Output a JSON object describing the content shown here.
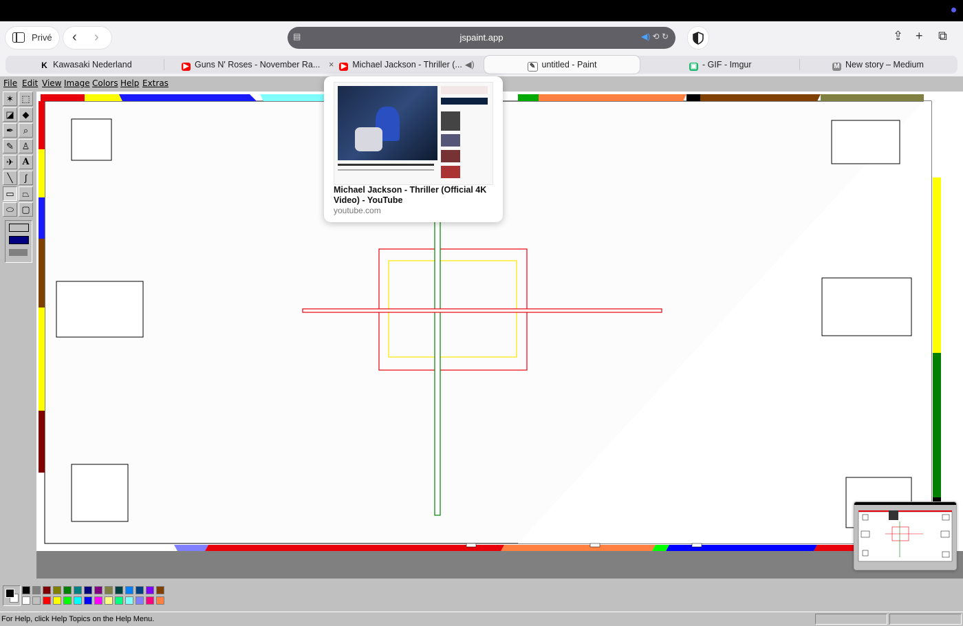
{
  "browser": {
    "profile_label": "Privé",
    "url": "jspaint.app",
    "tabs": [
      {
        "label": "Kawasaki Nederland",
        "icon": "kawasaki-icon"
      },
      {
        "label": "Guns N' Roses - November Ra...",
        "icon": "youtube-icon"
      },
      {
        "label": "Michael Jackson - Thriller (...",
        "icon": "youtube-icon",
        "close": "×"
      },
      {
        "label": "untitled - Paint",
        "icon": "paint-icon",
        "active": true
      },
      {
        "label": "- GIF - Imgur",
        "icon": "imgur-icon"
      },
      {
        "label": "New story – Medium",
        "icon": "medium-icon"
      }
    ],
    "colors": {
      "youtube_red": "#ff0000",
      "url_bar": "#606066",
      "accent": "#5a5cf0"
    }
  },
  "preview": {
    "title": "Michael Jackson - Thriller (Official 4K Video) - YouTube",
    "url": "youtube.com"
  },
  "paint": {
    "menus": [
      "File",
      "Edit",
      "View",
      "Image",
      "Colors",
      "Help",
      "Extras"
    ],
    "status_text": "For Help, click Help Topics on the Help Menu.",
    "palette_top": [
      "#000000",
      "#808080",
      "#800000",
      "#808000",
      "#008000",
      "#008080",
      "#000080",
      "#800080",
      "#808040",
      "#004040",
      "#0080ff",
      "#004080",
      "#8000ff",
      "#804000"
    ],
    "palette_bottom": [
      "#ffffff",
      "#c0c0c0",
      "#ff0000",
      "#ffff00",
      "#00ff00",
      "#00ffff",
      "#0000ff",
      "#ff00ff",
      "#ffff80",
      "#00ff80",
      "#80ffff",
      "#8080ff",
      "#ff0080",
      "#ff8040"
    ],
    "foreground_color": "#000000",
    "background_color": "#ffffff",
    "tools": [
      "free-form-select",
      "select",
      "eraser",
      "fill",
      "color-picker",
      "magnifier",
      "pencil",
      "brush",
      "airbrush",
      "text",
      "line",
      "curve",
      "rectangle",
      "polygon",
      "ellipse",
      "rounded-rectangle"
    ]
  }
}
